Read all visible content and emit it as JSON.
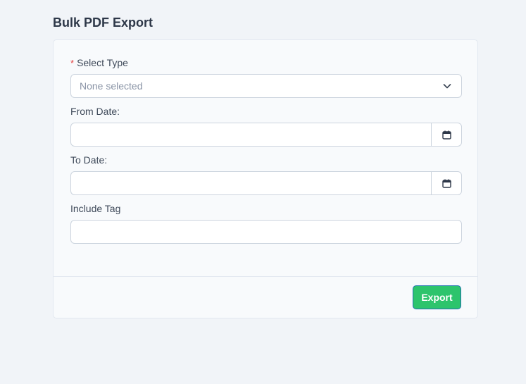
{
  "page": {
    "title": "Bulk PDF Export"
  },
  "form": {
    "select_type": {
      "required_mark": "*",
      "label": "Select Type",
      "value": "None selected"
    },
    "from_date": {
      "label": "From Date:",
      "value": ""
    },
    "to_date": {
      "label": "To Date:",
      "value": ""
    },
    "include_tag": {
      "label": "Include Tag",
      "value": ""
    }
  },
  "footer": {
    "export_label": "Export"
  },
  "colors": {
    "background": "#f1f4f8",
    "card": "#f8fafc",
    "export_button": "#2dc46c",
    "required": "#e53e3e"
  },
  "icons": {
    "select_chevron": "chevron-down-icon",
    "date_picker": "calendar-icon"
  }
}
